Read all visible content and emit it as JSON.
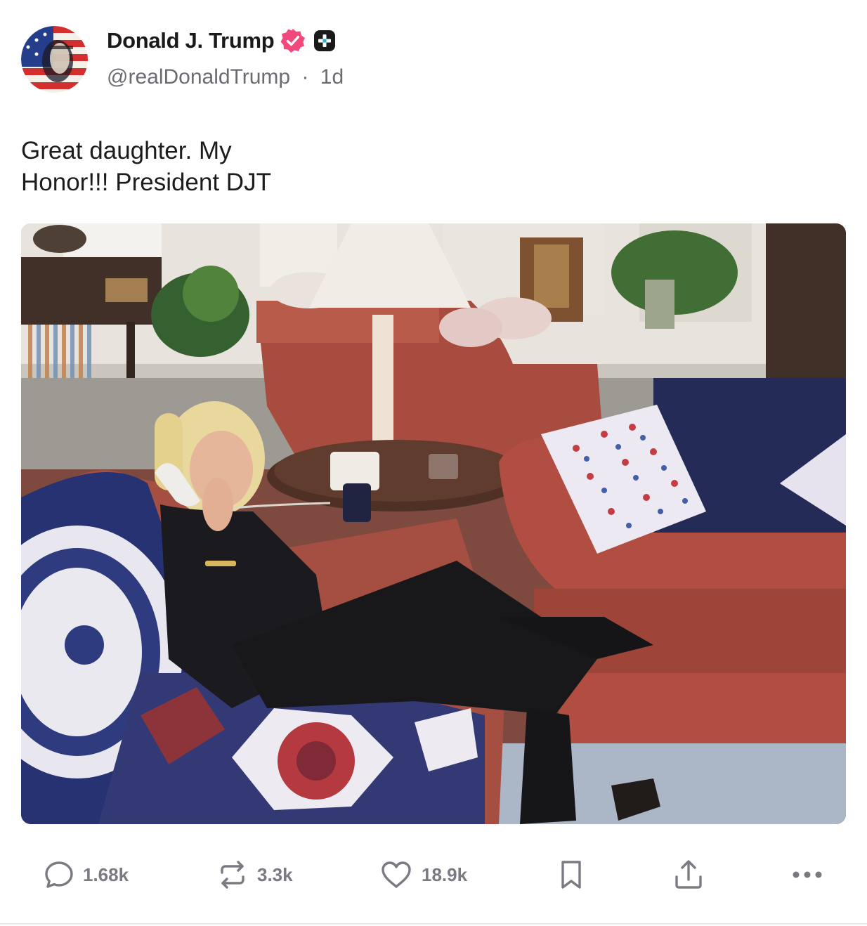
{
  "post": {
    "author": {
      "display_name": "Donald J. Trump",
      "handle": "@realDonaldTrump",
      "separator": "·",
      "time_ago": "1d",
      "verified_badge_color": "#f0497a",
      "verified_icon": "verified-check-icon",
      "platform_badge_icon": "plus-badge-icon"
    },
    "text_lines": [
      "Great daughter. My",
      "Honor!!! President DJT"
    ],
    "media": {
      "type": "photo",
      "icon": "photo-image"
    },
    "actions": {
      "reply": {
        "icon": "comment-icon",
        "count": "1.68k"
      },
      "repost": {
        "icon": "repost-icon",
        "count": "3.3k"
      },
      "like": {
        "icon": "heart-icon",
        "count": "18.9k"
      },
      "bookmark": {
        "icon": "bookmark-icon"
      },
      "share": {
        "icon": "share-icon"
      },
      "more": {
        "icon": "more-horizontal-icon"
      }
    }
  },
  "colors": {
    "icon_gray": "#7a7a82",
    "text_dark": "#1a1a1a",
    "muted": "#6b6b73"
  }
}
